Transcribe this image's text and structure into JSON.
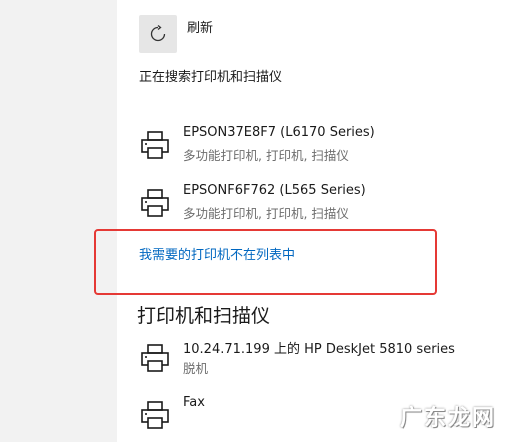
{
  "refresh": {
    "label": "刷新",
    "icon": "refresh-icon"
  },
  "status": {
    "searching": "正在搜索打印机和扫描仪"
  },
  "found_devices": [
    {
      "name": "EPSON37E8F7 (L6170 Series)",
      "description": "多功能打印机, 打印机, 扫描仪",
      "icon": "printer-icon"
    },
    {
      "name": "EPSONF6F762 (L565 Series)",
      "description": "多功能打印机, 打印机, 扫描仪",
      "icon": "printer-icon"
    }
  ],
  "missing_printer_link": "我需要的打印机不在列表中",
  "printers_section": {
    "title": "打印机和扫描仪",
    "items": [
      {
        "name": "10.24.71.199 上的 HP DeskJet 5810 series",
        "status": "脱机",
        "icon": "printer-icon"
      },
      {
        "name": "Fax",
        "status": "",
        "icon": "printer-icon"
      }
    ]
  },
  "watermark": "广东龙网",
  "colors": {
    "link": "#0067c0",
    "highlight": "#e53935",
    "panel": "#ffffff",
    "background": "#f2f2f2"
  }
}
